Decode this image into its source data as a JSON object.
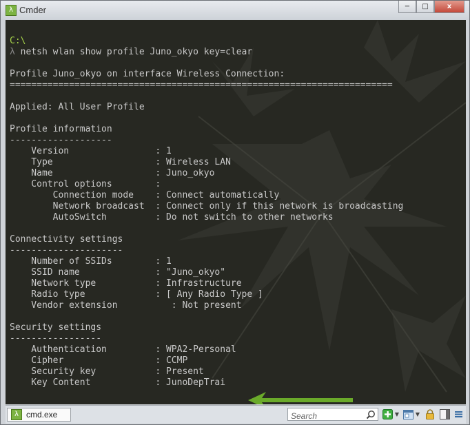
{
  "window": {
    "title": "Cmder",
    "app_icon": "lambda-icon",
    "controls": {
      "minimize": "−",
      "maximize": "□",
      "close": "x"
    }
  },
  "terminal": {
    "prompt_path": "C:\\",
    "prompt_symbol": "λ",
    "command": " netsh wlan show profile Juno_okyo key=clear",
    "output": [
      "",
      "Profile Juno_okyo on interface Wireless Connection:",
      "=======================================================================",
      "",
      "Applied: All User Profile",
      "",
      "Profile information",
      "-------------------",
      "    Version                : 1",
      "    Type                   : Wireless LAN",
      "    Name                   : Juno_okyo",
      "    Control options        :",
      "        Connection mode    : Connect automatically",
      "        Network broadcast  : Connect only if this network is broadcasting",
      "        AutoSwitch         : Do not switch to other networks",
      "",
      "Connectivity settings",
      "---------------------",
      "    Number of SSIDs        : 1",
      "    SSID name              : \"Juno_okyo\"",
      "    Network type           : Infrastructure",
      "    Radio type             : [ Any Radio Type ]",
      "    Vendor extension          : Not present",
      "",
      "Security settings",
      "-----------------",
      "    Authentication         : WPA2-Personal",
      "    Cipher                 : CCMP",
      "    Security key           : Present",
      "    Key Content            : JunoDepTrai"
    ],
    "colors": {
      "background": "#272822",
      "text": "#c9c9c9",
      "path": "#a6d34a"
    },
    "annotation": {
      "type": "arrow",
      "color": "#6aaa2a",
      "target": "Key Content"
    }
  },
  "statusbar": {
    "tab_label": "cmd.exe",
    "tab_icon": "lambda-icon",
    "search_placeholder": "Search",
    "tools": [
      "search-icon",
      "new-console-plus-icon",
      "dropdown-caret-icon",
      "window-layout-icon",
      "dropdown-caret-icon",
      "lock-icon",
      "split-view-icon",
      "menu-icon"
    ]
  }
}
